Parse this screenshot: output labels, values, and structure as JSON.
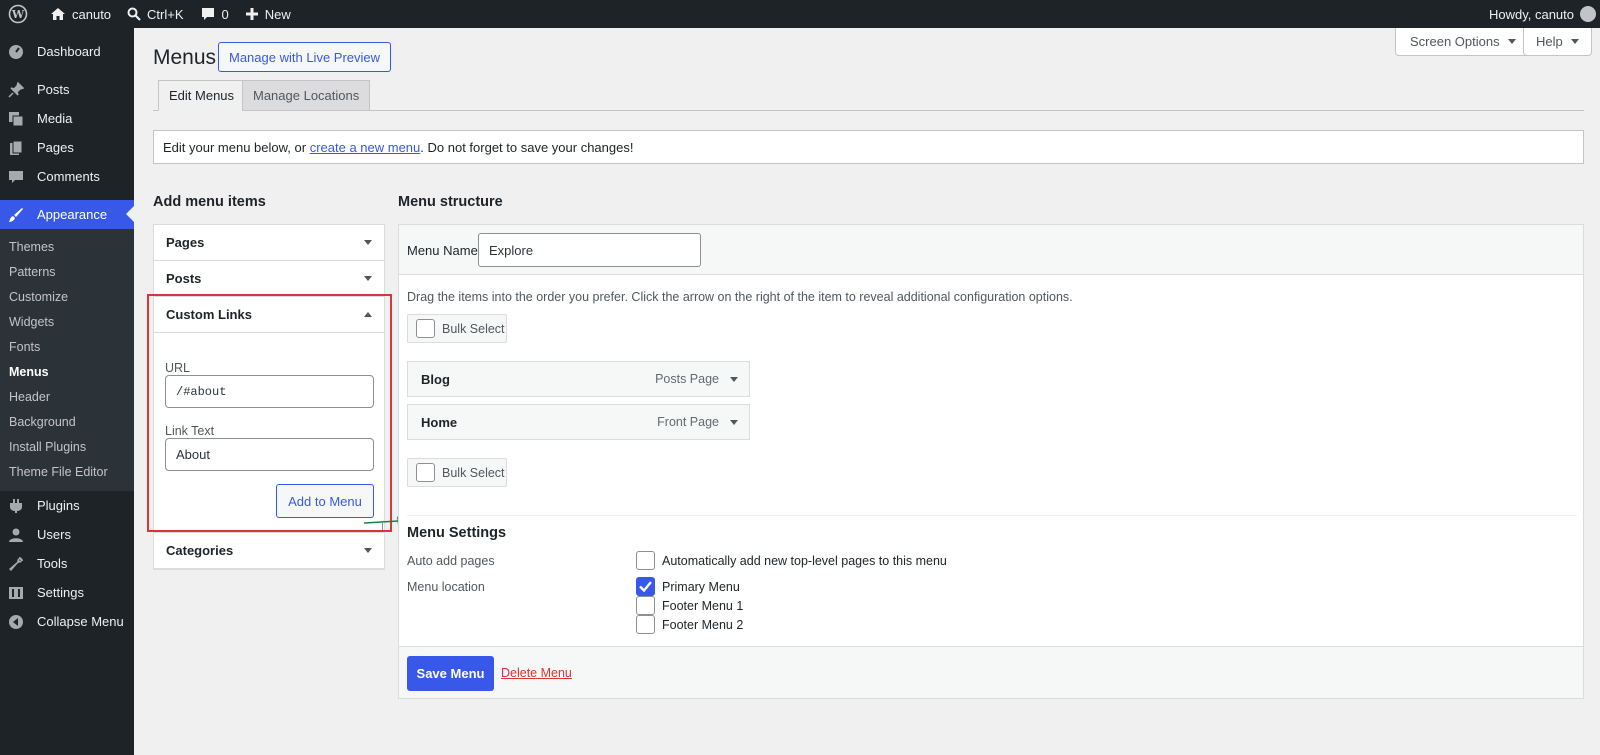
{
  "adminbar": {
    "site_name": "canuto",
    "command_palette": "Ctrl+K",
    "comments_count": "0",
    "new_label": "New",
    "greeting": "Howdy, canuto"
  },
  "sidebar": {
    "dashboard": "Dashboard",
    "posts": "Posts",
    "media": "Media",
    "pages": "Pages",
    "comments": "Comments",
    "appearance": "Appearance",
    "appearance_submenu": [
      "Themes",
      "Patterns",
      "Customize",
      "Widgets",
      "Fonts",
      "Menus",
      "Header",
      "Background",
      "Install Plugins",
      "Theme File Editor"
    ],
    "plugins": "Plugins",
    "users": "Users",
    "tools": "Tools",
    "settings": "Settings",
    "collapse": "Collapse Menu"
  },
  "header": {
    "title": "Menus",
    "live_preview": "Manage with Live Preview",
    "screen_options": "Screen Options",
    "help": "Help"
  },
  "tabs": [
    "Edit Menus",
    "Manage Locations"
  ],
  "notice": {
    "before": "Edit your menu below, or ",
    "link": "create a new menu",
    "after": ". Do not forget to save your changes!"
  },
  "add_items": {
    "heading": "Add menu items",
    "pages": "Pages",
    "posts": "Posts",
    "custom_links": "Custom Links",
    "url_label": "URL",
    "url_value": "/#about",
    "link_text_label": "Link Text",
    "link_text_value": "About",
    "add_button": "Add to Menu",
    "categories": "Categories"
  },
  "structure": {
    "heading": "Menu structure",
    "menu_name_label": "Menu Name",
    "menu_name_value": "Explore",
    "drag_hint": "Drag the items into the order you prefer. Click the arrow on the right of the item to reveal additional configuration options.",
    "bulk_select": "Bulk Select",
    "items": [
      {
        "title": "Blog",
        "type": "Posts Page"
      },
      {
        "title": "Home",
        "type": "Front Page"
      }
    ]
  },
  "menu_settings": {
    "title": "Menu Settings",
    "auto_add_label": "Auto add pages",
    "auto_add_text": "Automatically add new top-level pages to this menu",
    "location_label": "Menu location",
    "locations": [
      {
        "name": "Primary Menu",
        "checked": true
      },
      {
        "name": "Footer Menu 1",
        "checked": false
      },
      {
        "name": "Footer Menu 2",
        "checked": false
      }
    ]
  },
  "footer": {
    "save": "Save Menu",
    "delete": "Delete Menu"
  },
  "colors": {
    "accent": "#3858e9",
    "admin_dark": "#1d2327",
    "highlight_box": "#d63638",
    "arrow": "#1a7f4b"
  }
}
